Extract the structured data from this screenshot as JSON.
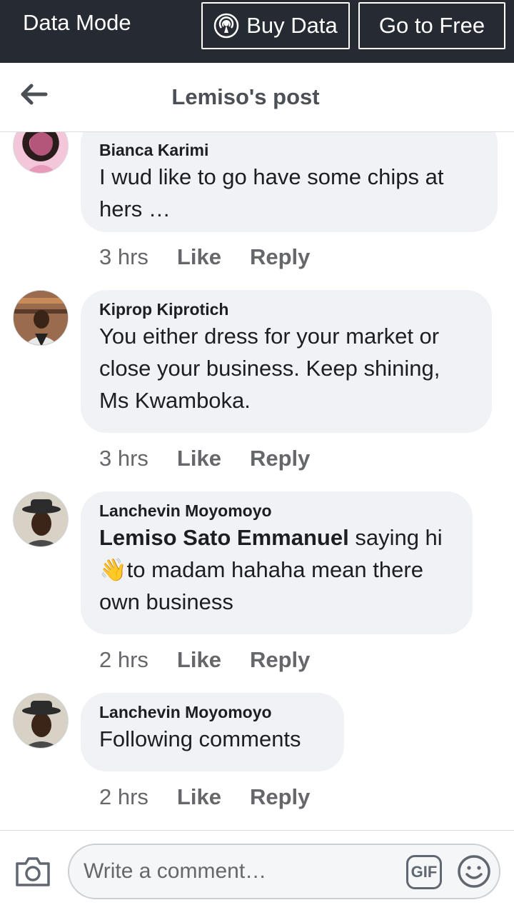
{
  "data_bar": {
    "mode_label": "Data Mode",
    "buy_data_label": "Buy Data",
    "go_free_label": "Go to Free"
  },
  "header": {
    "title": "Lemiso's post"
  },
  "comments": [
    {
      "author": "Bianca Karimi",
      "text": " I wud like to go have some chips at hers …",
      "time": "3 hrs",
      "like": "Like",
      "reply": "Reply"
    },
    {
      "author": "Kiprop Kiprotich",
      "text": "You either dress for your market or close your business. Keep shining, Ms Kwamboka.",
      "time": "3 hrs",
      "like": "Like",
      "reply": "Reply"
    },
    {
      "author": "Lanchevin Moyomoyo",
      "mention": "Lemiso Sato Emmanuel",
      "text_after_mention": " saying hi ",
      "emoji": "👋",
      "text_end": "to madam hahaha mean there own business",
      "time": "2 hrs",
      "like": "Like",
      "reply": "Reply"
    },
    {
      "author": "Lanchevin Moyomoyo",
      "text": "Following comments",
      "time": "2 hrs",
      "like": "Like",
      "reply": "Reply"
    }
  ],
  "composer": {
    "placeholder": "Write a comment…",
    "gif_label": "GIF",
    "icons": [
      "camera-icon",
      "gif-icon",
      "smiley-icon"
    ]
  },
  "colors": {
    "data_bar_bg": "#252a33",
    "bubble_bg": "#f0f2f5",
    "meta_text": "#65676b"
  }
}
